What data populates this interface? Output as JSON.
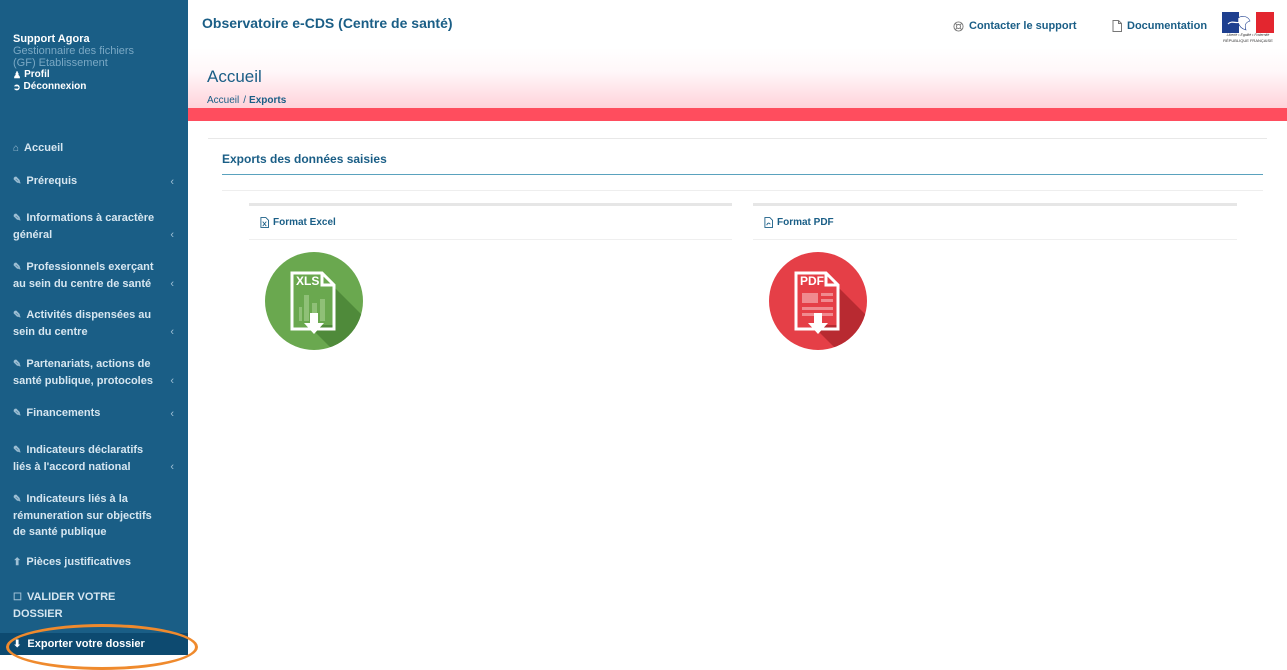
{
  "user": {
    "name": "Support Agora",
    "role_line1": "Gestionnaire des fichiers",
    "role_line2": "(GF) Etablissement",
    "profile_label": "Profil",
    "logout_label": "Déconnexion"
  },
  "menu": {
    "home": "Accueil",
    "items": [
      {
        "line1": "Prérequis",
        "line2": ""
      },
      {
        "line1": "Informations à caractère",
        "line2": "général"
      },
      {
        "line1": "Professionnels exerçant",
        "line2": "au sein du centre de santé"
      },
      {
        "line1": "Activités dispensées au",
        "line2": "sein du centre"
      },
      {
        "line1": "Partenariats, actions de",
        "line2": "santé publique, protocoles"
      },
      {
        "line1": "Financements",
        "line2": ""
      },
      {
        "line1": "Indicateurs déclaratifs",
        "line2": "liés à l'accord national"
      },
      {
        "line1": "Indicateurs liés à la",
        "line2": "rémuneration sur objectifs",
        "line3": "de santé publique"
      }
    ],
    "pieces": "Pièces justificatives",
    "validate_line1": "VALIDER VOTRE",
    "validate_line2": "DOSSIER",
    "export": "Exporter votre dossier"
  },
  "header": {
    "app_title": "Observatoire e-CDS (Centre de santé)",
    "support_label": "Contacter le support",
    "documentation_label": "Documentation",
    "logo_text": "Liberté • Égalité • Fraternité",
    "logo_subtext": "RÉPUBLIQUE FRANÇAISE"
  },
  "page": {
    "title": "Accueil",
    "breadcrumb_home": "Accueil",
    "breadcrumb_current": "Exports"
  },
  "exports": {
    "section_title": "Exports des données saisies",
    "excel_label": "Format Excel",
    "excel_icon_text": "XLS",
    "pdf_label": "Format PDF",
    "pdf_icon_text": "PDF"
  },
  "colors": {
    "sidebar": "#1a5e86",
    "accent_red": "#ff4d5e",
    "excel_green": "#6aa84f",
    "pdf_red": "#e53f47",
    "highlight": "#ef8a2d"
  }
}
